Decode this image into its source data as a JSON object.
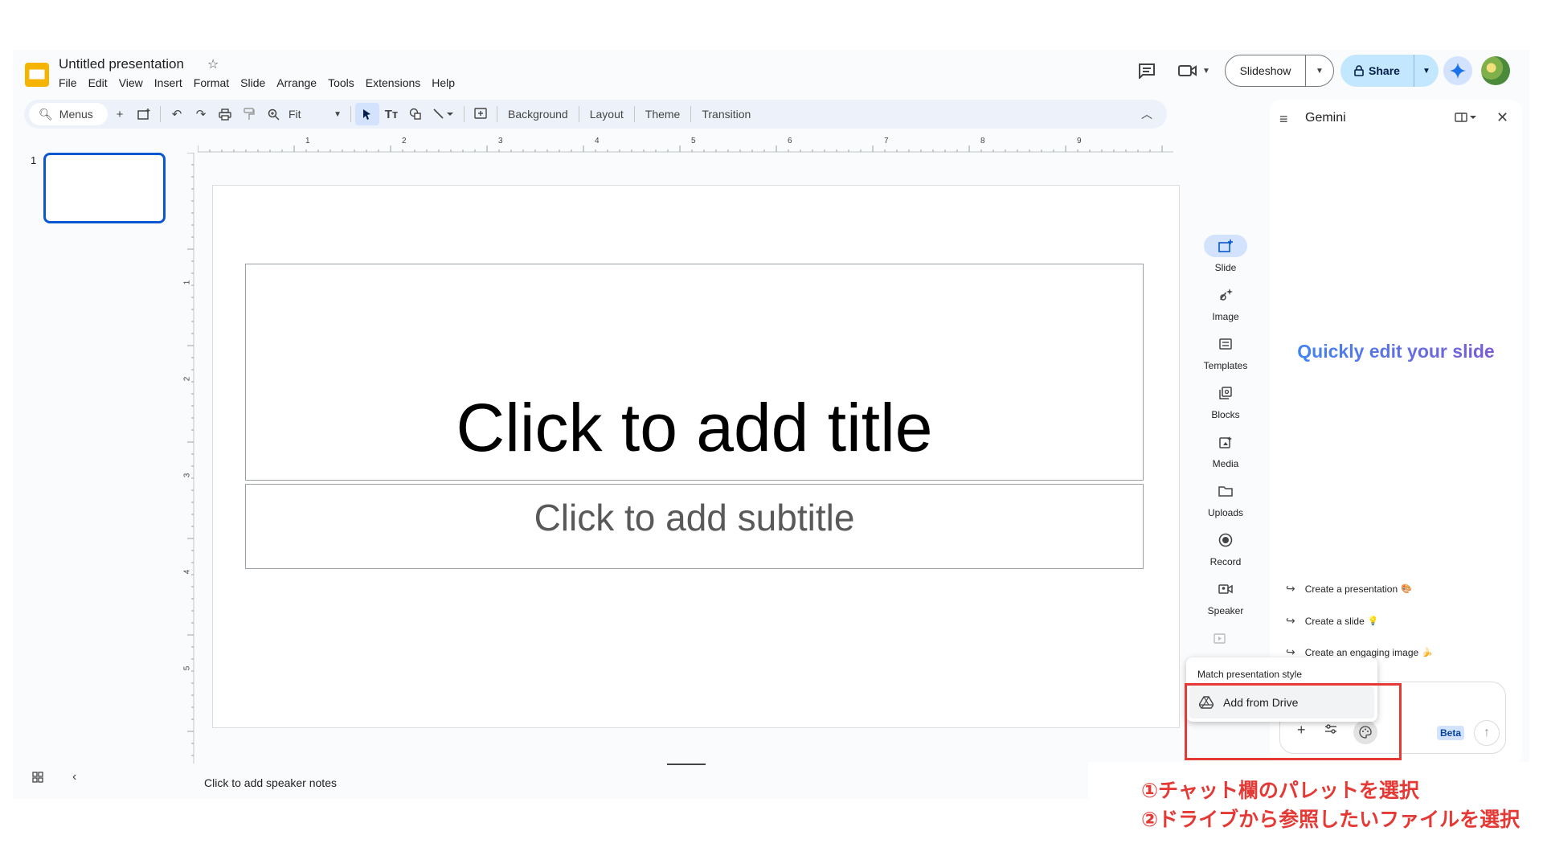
{
  "header": {
    "doc_title": "Untitled presentation",
    "menu": [
      "File",
      "Edit",
      "View",
      "Insert",
      "Format",
      "Slide",
      "Arrange",
      "Tools",
      "Extensions",
      "Help"
    ],
    "slideshow_label": "Slideshow",
    "share_label": "Share"
  },
  "toolbar": {
    "menus_label": "Menus",
    "zoom_value": "Fit",
    "background_label": "Background",
    "layout_label": "Layout",
    "theme_label": "Theme",
    "transition_label": "Transition"
  },
  "filmstrip": {
    "slide_number": "1"
  },
  "rulers": {
    "top_ticks": [
      "1",
      "2",
      "3",
      "4",
      "5",
      "6",
      "7",
      "8",
      "9"
    ],
    "left_ticks": [
      "1",
      "2",
      "3",
      "4",
      "5"
    ]
  },
  "slide": {
    "title_placeholder": "Click to add title",
    "subtitle_placeholder": "Click to add subtitle"
  },
  "notes": {
    "placeholder": "Click to add speaker notes"
  },
  "side_rail": {
    "items": [
      {
        "label": "Slide",
        "icon": "add-slide-icon"
      },
      {
        "label": "Image",
        "icon": "image-spark-icon"
      },
      {
        "label": "Templates",
        "icon": "templates-icon"
      },
      {
        "label": "Blocks",
        "icon": "blocks-icon"
      },
      {
        "label": "Media",
        "icon": "media-icon"
      },
      {
        "label": "Uploads",
        "icon": "folder-icon"
      },
      {
        "label": "Record",
        "icon": "record-icon"
      },
      {
        "label": "Speaker",
        "icon": "speaker-video-icon"
      }
    ]
  },
  "gemini": {
    "title": "Gemini",
    "hero": "Quickly edit your slide",
    "suggestions": [
      {
        "label": "Create a presentation",
        "emoji": "🎨"
      },
      {
        "label": "Create a slide",
        "emoji": "💡"
      },
      {
        "label": "Create an engaging image",
        "emoji": "🍌"
      }
    ],
    "beta_label": "Beta"
  },
  "popover": {
    "heading": "Match presentation style",
    "item_label": "Add from Drive"
  },
  "annotation": {
    "line1": "①チャット欄のパレットを選択",
    "line2": "②ドライブから参照したいファイルを選択",
    "color": "#e53935"
  },
  "colors": {
    "accent": "#0b57d0",
    "share_bg": "#c2e7ff",
    "toolbar_bg": "#edf2fa"
  }
}
